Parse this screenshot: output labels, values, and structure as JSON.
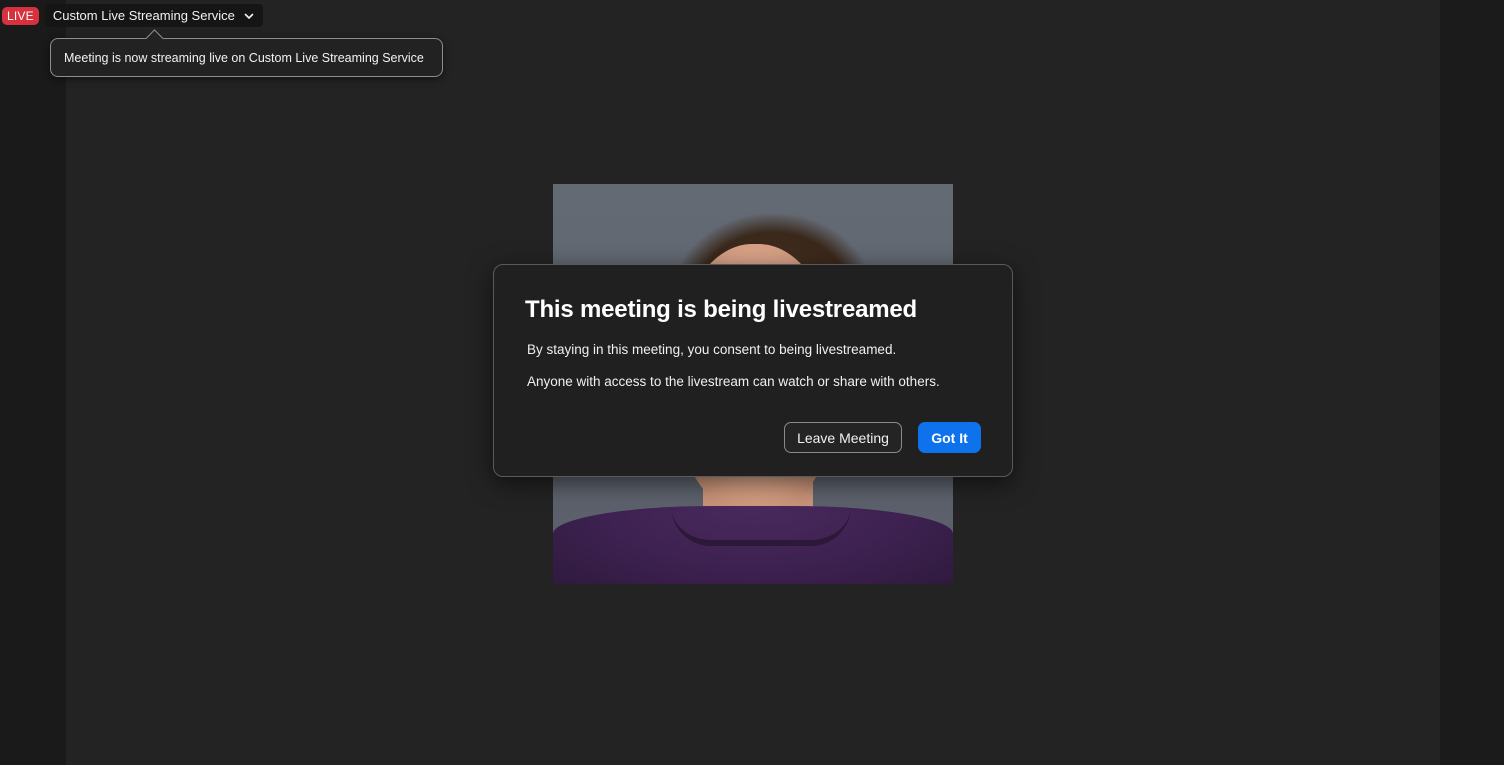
{
  "live_bar": {
    "badge": "LIVE",
    "service_name": "Custom Live Streaming Service",
    "badge_color": "#d6313d"
  },
  "tooltip": {
    "text": "Meeting is now streaming live on Custom Live Streaming Service"
  },
  "modal": {
    "title": "This meeting is being livestreamed",
    "line1": "By staying in this meeting, you consent to being livestreamed.",
    "line2": "Anyone with access to the livestream can watch or share with others.",
    "leave_label": "Leave Meeting",
    "ok_label": "Got It",
    "accent_color": "#0e72ed"
  },
  "icons": {
    "dropdown": "chevron-down-icon"
  }
}
